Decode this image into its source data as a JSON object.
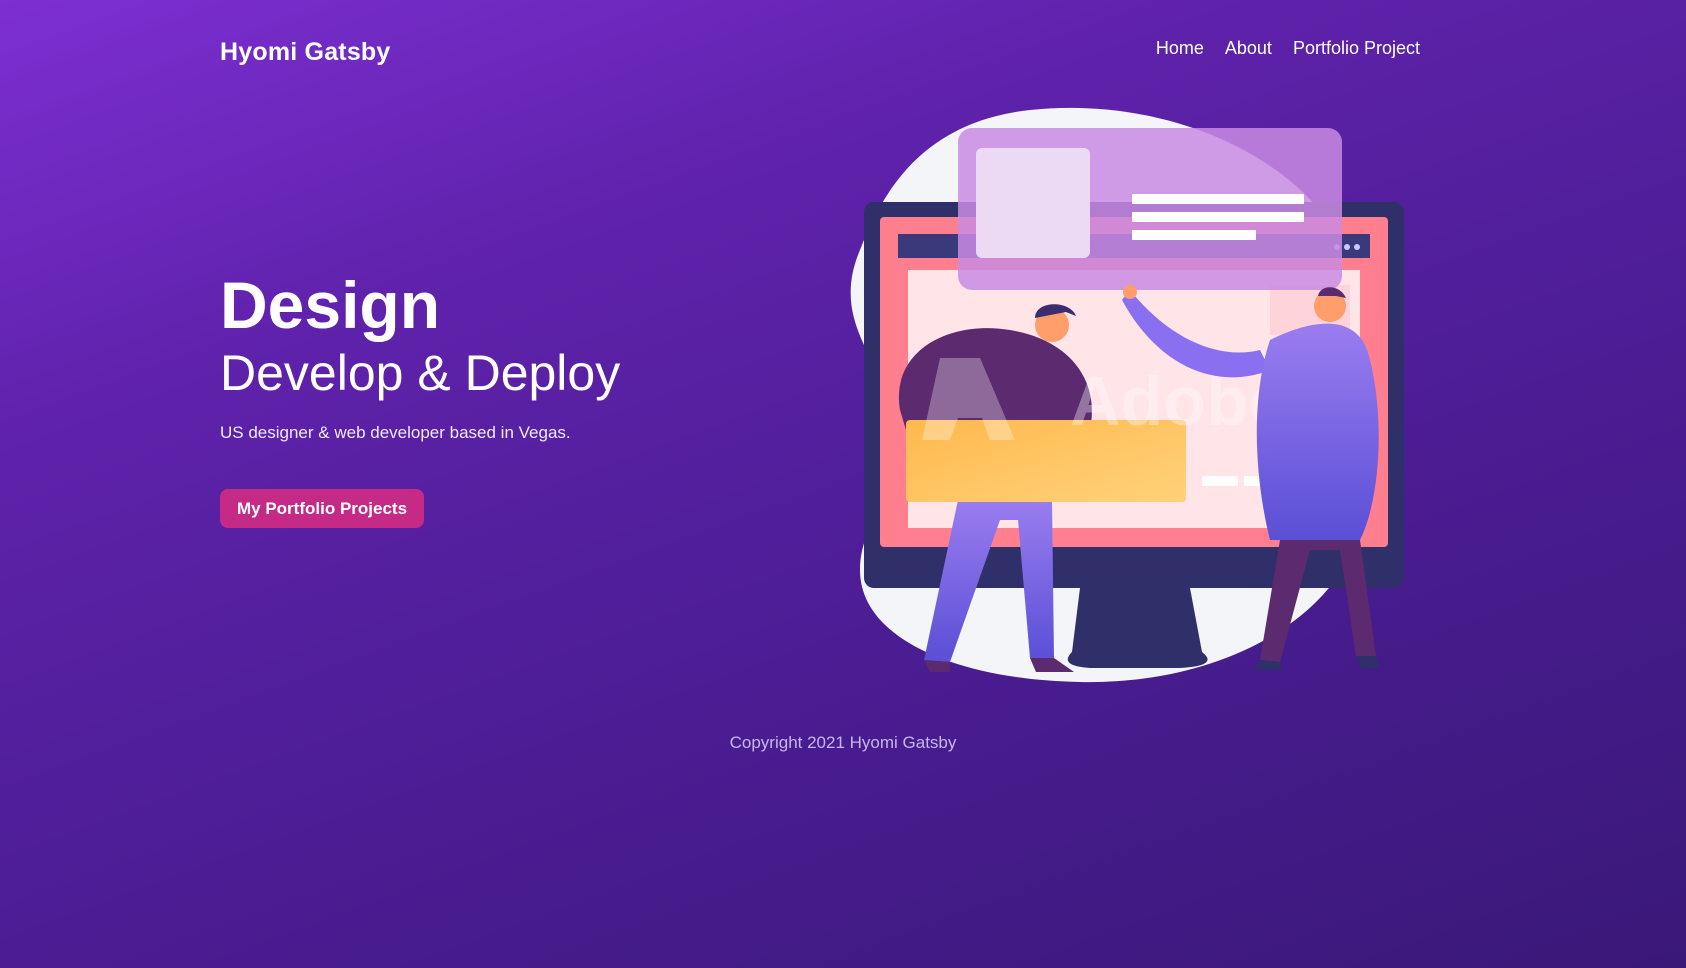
{
  "header": {
    "brand": "Hyomi Gatsby",
    "nav": [
      {
        "label": "Home"
      },
      {
        "label": "About"
      },
      {
        "label": "Portfolio Project"
      }
    ]
  },
  "hero": {
    "title": "Design",
    "subtitle": "Develop & Deploy",
    "description": "US designer & web developer based in Vegas.",
    "cta_label": "My Portfolio Projects"
  },
  "illustration": {
    "watermark": "Adobe",
    "icon": "designer-developer-illustration"
  },
  "footer": {
    "copyright": "Copyright 2021 Hyomi Gatsby"
  },
  "colors": {
    "background_start": "#7d2fd2",
    "background_end": "#3a1878",
    "accent": "#c42a86",
    "screen": "#ff7f8f",
    "panel": "#c98be3",
    "box": "#ffc15a"
  }
}
